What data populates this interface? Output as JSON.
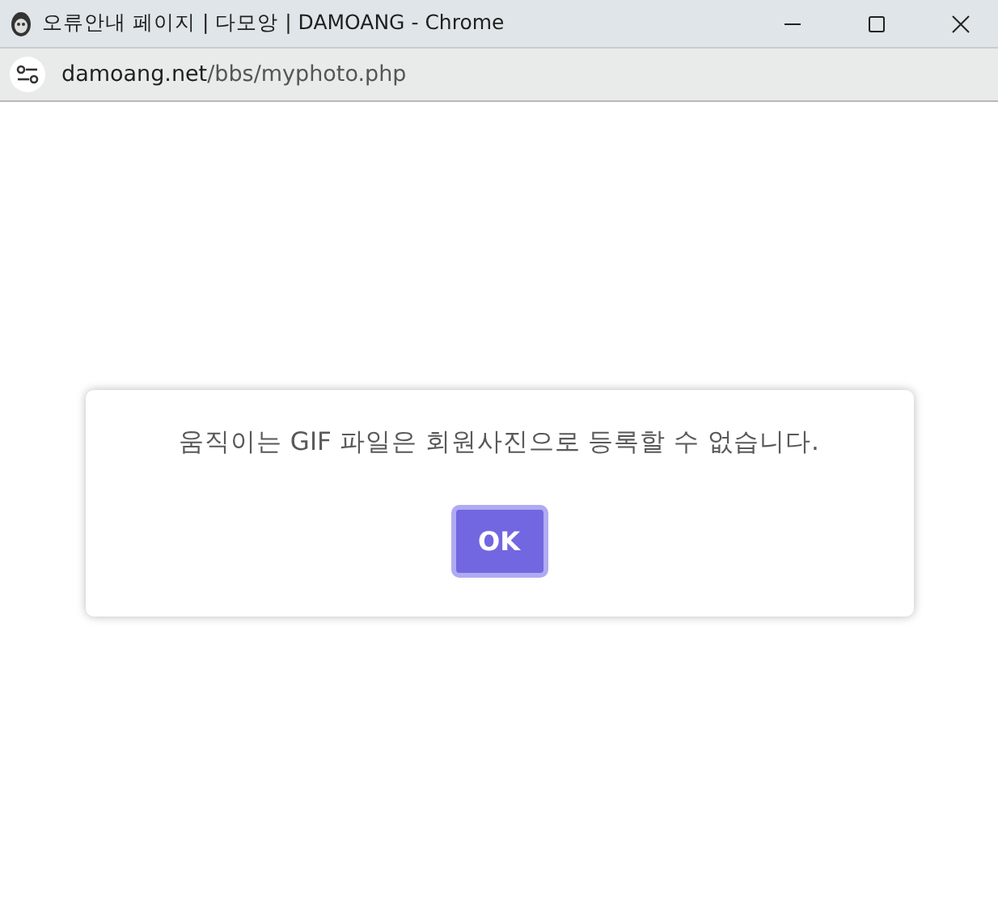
{
  "window": {
    "title": "오류안내 페이지 | 다모앙 | DAMOANG - Chrome"
  },
  "address_bar": {
    "host": "damoang.net",
    "path": "/bbs/myphoto.php"
  },
  "dialog": {
    "message": "움직이는 GIF 파일은 회원사진으로 등록할 수 없습니다.",
    "button": {
      "label": "OK",
      "focused": true
    }
  }
}
